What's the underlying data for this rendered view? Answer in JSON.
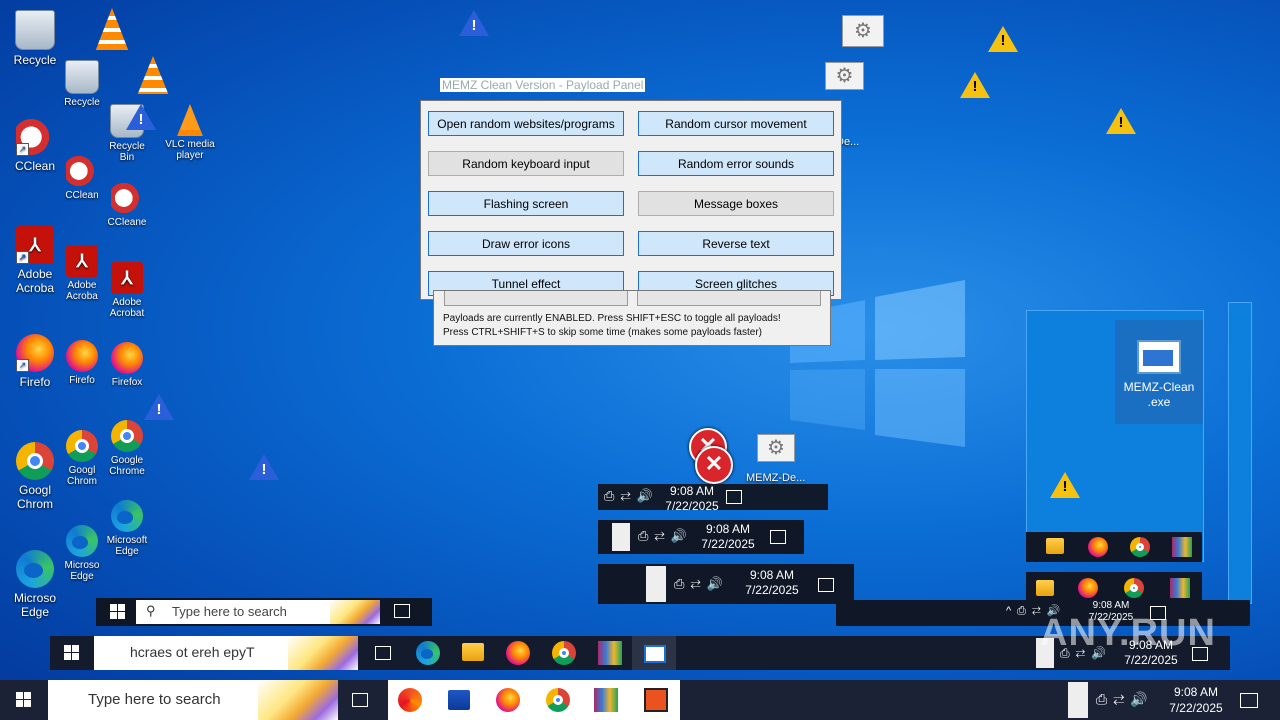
{
  "desktop": {
    "icons_col1": [
      {
        "label": "Recycle"
      },
      {
        "label": "CClean"
      },
      {
        "label": "Adobe Acroba"
      },
      {
        "label": "Firefo"
      },
      {
        "label": "Googl Chrom"
      },
      {
        "label": "Microso Edge"
      }
    ],
    "icons_col2": [
      {
        "label": "Recycle"
      },
      {
        "label": "CClean"
      },
      {
        "label": "Adobe Acroba"
      },
      {
        "label": "Firefo"
      },
      {
        "label": "Googl Chrom"
      },
      {
        "label": "Microso Edge"
      }
    ],
    "icons_col3": [
      {
        "label": "Recycle Bin"
      },
      {
        "label": "VLC media player"
      },
      {
        "label": "CCleane"
      },
      {
        "label": "Adobe Acrobat"
      },
      {
        "label": "Firefox"
      },
      {
        "label": "Google Chrome"
      },
      {
        "label": "Microsoft Edge"
      }
    ],
    "memz_file": {
      "label": "MEMZ-Clean .exe"
    },
    "ghost_label": "MEMZ-De...",
    "ghost_label2": "De..."
  },
  "panel": {
    "title": "MEMZ Clean Version - Payload Panel",
    "buttons": [
      {
        "label": "Open random websites/programs",
        "enabled": true
      },
      {
        "label": "Random cursor movement",
        "enabled": true
      },
      {
        "label": "Random keyboard input",
        "enabled": false
      },
      {
        "label": "Random error sounds",
        "enabled": true
      },
      {
        "label": "Flashing screen",
        "enabled": true
      },
      {
        "label": "Message boxes",
        "enabled": false
      },
      {
        "label": "Draw error icons",
        "enabled": true
      },
      {
        "label": "Reverse text",
        "enabled": true
      },
      {
        "label": "Tunnel effect",
        "enabled": true
      },
      {
        "label": "Screen glitches",
        "enabled": true
      }
    ],
    "info_line1": "Payloads are currently ENABLED. Press SHIFT+ESC to toggle all payloads!",
    "info_line2": "Press CTRL+SHIFT+S to skip some time (makes some payloads faster)"
  },
  "taskbar": {
    "search_placeholder": "Type here to search",
    "reversed_search": "hcraes ot ereh epyT",
    "small_search": "Type here to search",
    "time": "9:08 AM",
    "date": "7/22/2025",
    "ghost_date": "7/22/2025"
  },
  "watermark": "ANY.RUN"
}
